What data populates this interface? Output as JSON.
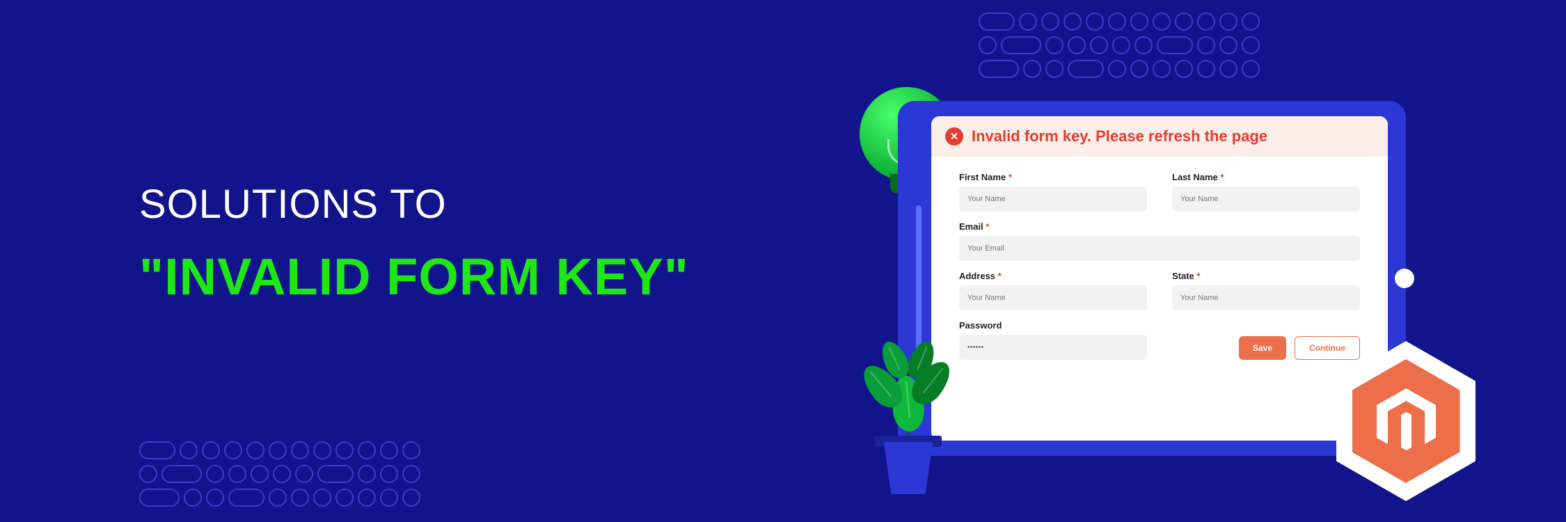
{
  "heading": {
    "line1": "SOLUTIONS TO",
    "line2": "\"INVALID FORM KEY\""
  },
  "error_message": "Invalid form key. Please refresh the page",
  "form": {
    "fields": {
      "first_name": {
        "label": "First Name",
        "placeholder": "Your Name",
        "required": true
      },
      "last_name": {
        "label": "Last Name",
        "placeholder": "Your Name",
        "required": true
      },
      "email": {
        "label": "Email",
        "placeholder": "Your Email",
        "required": true
      },
      "address": {
        "label": "Address",
        "placeholder": "Your Name",
        "required": true
      },
      "state": {
        "label": "State",
        "placeholder": "Your Name",
        "required": true
      },
      "password": {
        "label": "Password",
        "placeholder": "••••••",
        "required": false
      }
    },
    "buttons": {
      "save": "Save",
      "continue": "Continue"
    }
  },
  "colors": {
    "background": "#12148c",
    "accent_green": "#1de815",
    "error_red": "#e43c2f",
    "button_orange": "#ec6f4a",
    "tablet_blue": "#2b38d6"
  }
}
